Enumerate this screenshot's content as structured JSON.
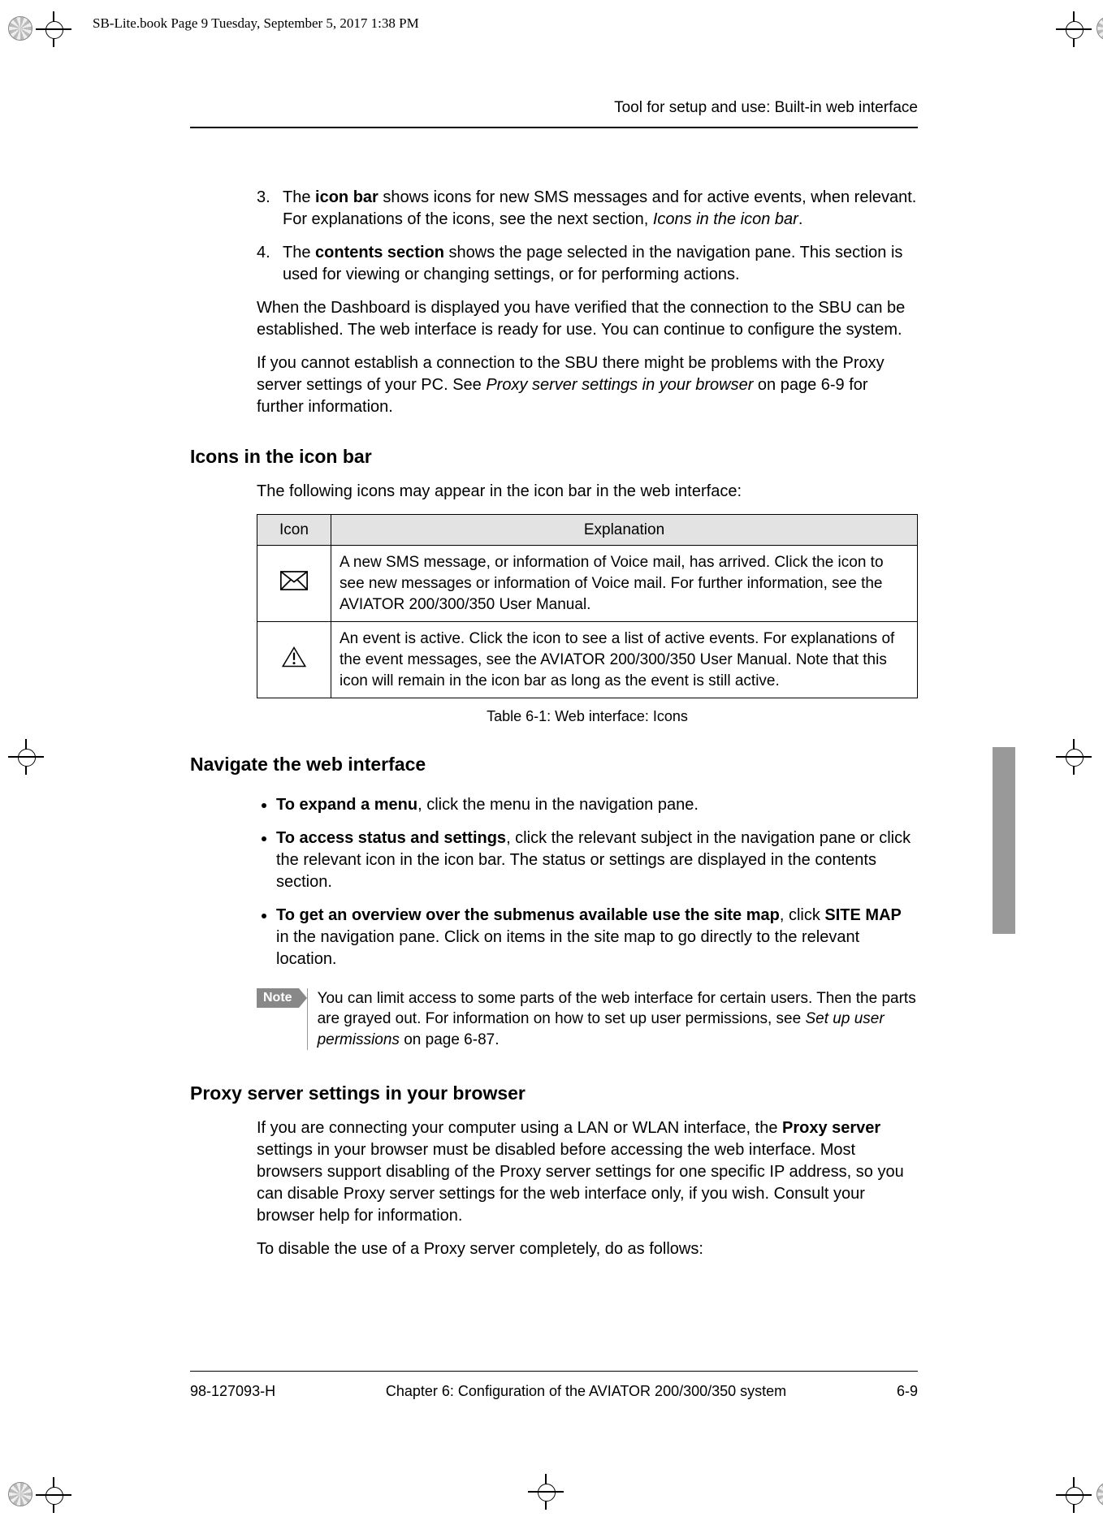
{
  "stamp": "SB-Lite.book  Page 9  Tuesday, September 5, 2017  1:38 PM",
  "running_head": "Tool for setup and use: Built-in web interface",
  "list_items": {
    "item3": {
      "num": "3.",
      "bold": "icon bar",
      "pre": "The ",
      "post": " shows icons for new SMS messages and for active events, when relevant. For explanations of the icons, see the next section, ",
      "ital": "Icons in the icon bar",
      "end": "."
    },
    "item4": {
      "num": "4.",
      "bold": "contents section",
      "pre": "The ",
      "post": " shows the page selected in the navigation pane. This section is used for viewing or changing settings, or for performing actions."
    }
  },
  "para1": "When the Dashboard is displayed you have verified that the connection to the SBU can be established. The web interface is ready for use. You can continue to configure the system.",
  "para2_pre": "If you cannot establish a connection to the SBU there might be problems with the Proxy server settings of your PC. See ",
  "para2_ital": "Proxy server settings in your browser",
  "para2_post": " on page 6-9 for further information.",
  "h_icons": "Icons in the icon bar",
  "icons_intro": "The following icons may appear in the icon bar in the web interface:",
  "table": {
    "head_icon": "Icon",
    "head_expl": "Explanation",
    "row1": "A new SMS message, or information of Voice mail, has arrived. Click the icon to see new messages or information of Voice mail. For further information, see the AVIATOR 200/300/350 User Manual.",
    "row2": "An event is active. Click the icon to see a list of active events. For explanations of the event messages, see the AVIATOR 200/300/350 User Manual. Note that this icon will remain in the icon bar as long as the event is still active.",
    "caption": "Table 6-1: Web interface: Icons"
  },
  "h_nav": "Navigate the web interface",
  "bul1": {
    "bold": "To expand a menu",
    "text": ", click the menu in the navigation pane."
  },
  "bul2": {
    "bold": "To access status and settings",
    "text": ", click the relevant subject in the navigation pane or click the relevant icon in the icon bar. The status or settings are displayed in the contents section."
  },
  "bul3": {
    "bold1": "To get an overview over the submenus available use the site map",
    "mid": ", click ",
    "bold2": "SITE MAP",
    "text": " in the navigation pane. Click on items in the site map to go directly to the relevant location."
  },
  "note_label": "Note",
  "note_text_pre": "You can limit access to some parts of the web interface for certain users. Then the parts are grayed out. For information on how to set up user permissions, see ",
  "note_ital": "Set up user permissions",
  "note_text_post": " on page 6-87.",
  "h_proxy": "Proxy server settings in your browser",
  "proxy_p1_pre": "If you are connecting your computer using a LAN or WLAN interface, the ",
  "proxy_p1_bold": "Proxy server",
  "proxy_p1_post": " settings in your browser must be disabled before accessing the web interface. Most browsers support disabling of the Proxy server settings for one specific IP address, so you can disable Proxy server settings for the web interface only, if you wish. Consult your browser help for information.",
  "proxy_p2": "To disable the use of a Proxy server completely, do as follows:",
  "footer": {
    "doc": "98-127093-H",
    "chapter": "Chapter 6:  Configuration of the AVIATOR 200/300/350 system",
    "page": "6-9"
  }
}
